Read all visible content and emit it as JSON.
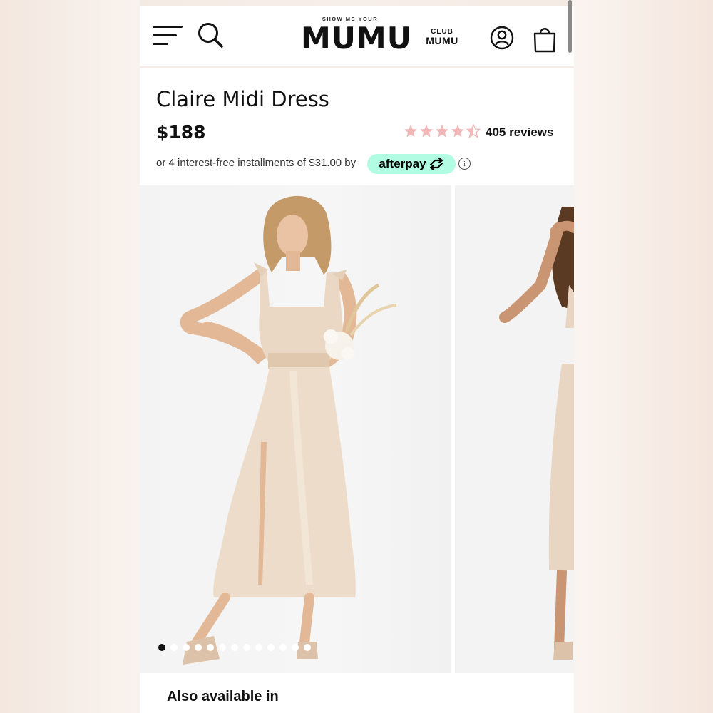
{
  "header": {
    "brand_small": "SHOW ME YOUR",
    "brand_big": "MUMU",
    "club_line1": "CLUB",
    "club_line2": "MUMU",
    "icons": [
      "menu-icon",
      "search-icon",
      "account-icon",
      "shopping-bag-icon"
    ]
  },
  "product": {
    "title": "Claire Midi Dress",
    "price": "$188",
    "rating": 4.5,
    "rating_max": 5,
    "reviews": "405 reviews",
    "installments_text": "or 4 interest-free installments of $31.00 by",
    "afterpay_label": "afterpay",
    "info_glyph": "i"
  },
  "gallery": {
    "image_count": 13,
    "active_index": 0
  },
  "section": {
    "also_available": "Also available in"
  },
  "colors": {
    "star": "#f2b7b7",
    "afterpay_bg": "#b2fce4",
    "dress": "#e9d6c2"
  }
}
